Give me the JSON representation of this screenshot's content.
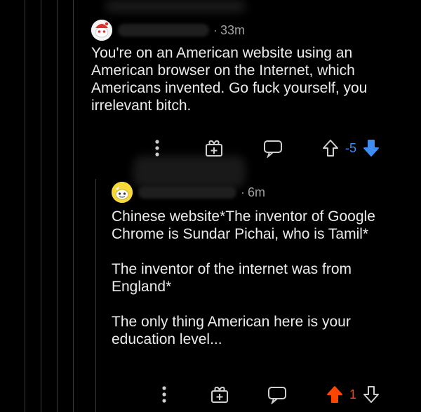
{
  "comments": [
    {
      "id": "parent",
      "separator": "·",
      "time": "33m",
      "body": "You're on an American website using an\nAmerican browser on the Internet, which\nAmericans invented. Go fuck yourself, you\nirrelevant bitch.",
      "score": "-5",
      "vote_state": "downvoted",
      "avatar_icon": "snoo-avatar-red-icon"
    },
    {
      "id": "reply",
      "separator": "·",
      "time": "6m",
      "body": "Chinese website*The inventor of Google\nChrome is Sundar Pichai, who is Tamil*\n\nThe inventor of the internet was from\nEngland*\n\nThe only thing American here is your\neducation level...",
      "score": "1",
      "vote_state": "upvoted",
      "avatar_icon": "snoo-avatar-yellow-icon"
    }
  ],
  "colors": {
    "background": "#000000",
    "text": "#ececec",
    "meta": "#a0a0a0",
    "thread_line": "#3a3a3a",
    "downvote": "#3f8cf2",
    "upvote": "#ff4500",
    "icon": "#cfcfcf"
  },
  "icons": {
    "more": "more-vertical-icon",
    "award": "gift-award-icon",
    "reply": "reply-bubble-icon",
    "upvote": "upvote-arrow-icon",
    "downvote": "downvote-arrow-icon"
  }
}
